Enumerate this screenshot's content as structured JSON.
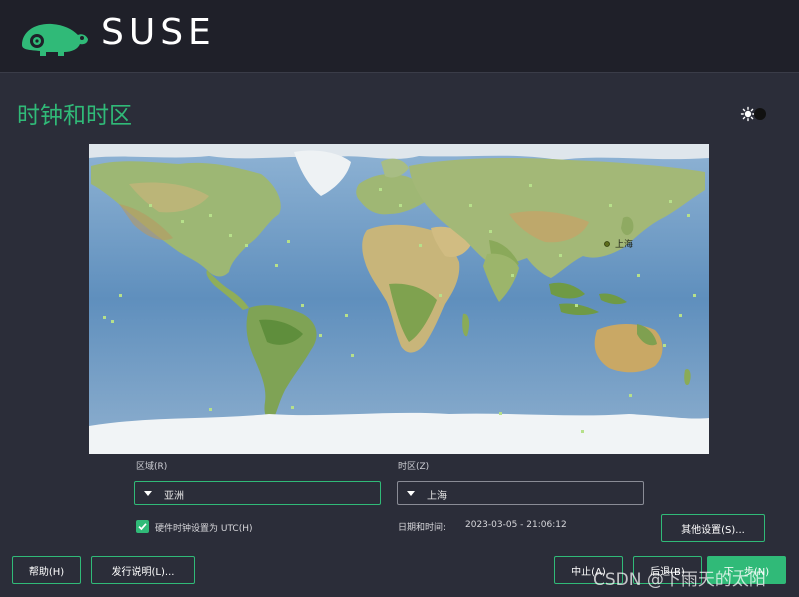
{
  "app": {
    "brand": "SUSE"
  },
  "page": {
    "title": "时钟和时区"
  },
  "map": {
    "selected_city_label": "上海"
  },
  "region": {
    "label": "区域(R)",
    "value": "亚洲"
  },
  "timezone": {
    "label": "时区(Z)",
    "value": "上海"
  },
  "hardware_clock": {
    "label": "硬件时钟设置为 UTC(H)",
    "checked": true
  },
  "datetime": {
    "label": "日期和时间:",
    "value": "2023-03-05 - 21:06:12"
  },
  "buttons": {
    "other_settings": "其他设置(S)...",
    "help": "帮助(H)",
    "release_notes": "发行说明(L)...",
    "abort": "中止(A)",
    "back": "后退(B)",
    "next": "下一步(N)"
  },
  "watermark": "CSDN @下雨天的太阳",
  "colors": {
    "accent": "#30ba78",
    "background": "#2b2d39",
    "header": "#1f2029"
  }
}
